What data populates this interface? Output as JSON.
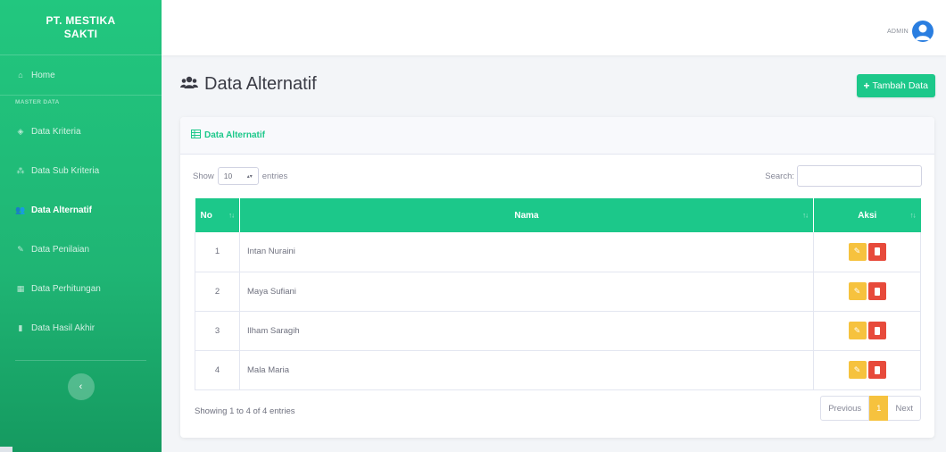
{
  "sidebar": {
    "brand_line1": "PT. MESTIKA",
    "brand_line2": "SAKTI",
    "home": "Home",
    "section_heading": "MASTER DATA",
    "items": [
      {
        "label": "Data Kriteria",
        "icon": "cube-icon"
      },
      {
        "label": "Data Sub Kriteria",
        "icon": "cubes-icon"
      },
      {
        "label": "Data Alternatif",
        "icon": "users-icon"
      },
      {
        "label": "Data Penilaian",
        "icon": "edit-icon"
      },
      {
        "label": "Data Perhitungan",
        "icon": "calculator-icon"
      },
      {
        "label": "Data Hasil Akhir",
        "icon": "chart-icon"
      }
    ],
    "active_index": 2
  },
  "topbar": {
    "user_name": "ADMIN"
  },
  "page": {
    "title": "Data Alternatif",
    "add_button": "Tambah Data"
  },
  "card": {
    "header": "Data Alternatif",
    "show_label": "Show",
    "entries_label": "entries",
    "page_length": "10",
    "search_label": "Search:",
    "search_value": "",
    "columns": [
      "No",
      "Nama",
      "Aksi"
    ],
    "rows": [
      {
        "no": "1",
        "nama": "Intan Nuraini"
      },
      {
        "no": "2",
        "nama": "Maya Sufiani"
      },
      {
        "no": "3",
        "nama": "Ilham Saragih"
      },
      {
        "no": "4",
        "nama": "Mala Maria"
      }
    ],
    "info": "Showing 1 to 4 of 4 entries",
    "pagination": {
      "previous": "Previous",
      "current": "1",
      "next": "Next"
    }
  },
  "colors": {
    "sidebar": "#1fb574",
    "accent": "#1cc88a",
    "edit": "#f6c23e",
    "delete": "#e74a3b"
  }
}
